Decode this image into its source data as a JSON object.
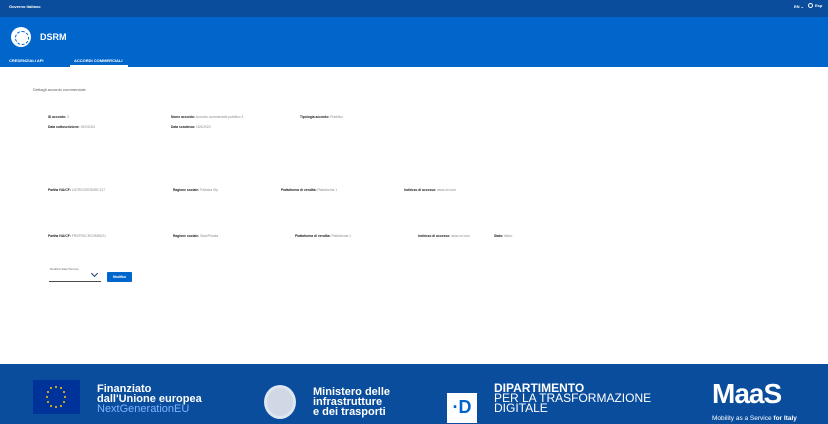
{
  "topbar": {
    "gov_label": "Governo Italiano",
    "lang": "EN ⌄",
    "user": "Esp"
  },
  "header": {
    "brand": "DSRM",
    "nav": [
      "CREDENZIALI API",
      "ACCORDI COMMERCIALI"
    ]
  },
  "main": {
    "section_title": "Dettagli accordo commerciale",
    "agreement": {
      "id_label": "ID accordo:",
      "id_value": "3",
      "name_label": "Nome accordo:",
      "name_value": "Accordo commerciale pubblico 3",
      "type_label": "Tipologia accordo:",
      "type_value": "Pubblico",
      "signed_label": "Data sottoscrizione:",
      "signed_value": "19/2/2024",
      "expiry_label": "Data scadenza:",
      "expiry_value": "15/4/2024"
    },
    "parties": [
      {
        "vat_label": "Partita IVA/CF:",
        "vat_value": "LNTRDCREDMRC217",
        "company_label": "Ragione sociale:",
        "company_value": "Palestra Sty",
        "platform_label": "Piattaforma di vendita:",
        "platform_value": "Piattaforma 1",
        "email_label": "Indirizzo di accesso:",
        "email_value": "www.url.com"
      },
      {
        "vat_label": "Partita IVA/CF:",
        "vat_value": "FRNTRDCRCHMBG21",
        "company_label": "Ragione sociale:",
        "company_value": "StarkPrivata",
        "platform_label": "Piattaforma di vendita:",
        "platform_value": "Piattaforma 1",
        "email_label": "Indirizzo di accesso:",
        "email_value": "www.url.com",
        "status_label": "Stato:",
        "status_value": "Attivo"
      }
    ],
    "select": {
      "label": "Modifica Stato/Termina"
    },
    "button": "Modifica"
  },
  "footer": {
    "eu": [
      "Finanziato",
      "dall'Unione europea",
      "NextGenerationEU"
    ],
    "ministry": [
      "Ministero delle",
      "infrastrutture",
      "e dei trasporti"
    ],
    "dip": [
      "DIPARTIMENTO",
      "PER LA TRASFORMAZIONE",
      "DIGITALE"
    ],
    "d_letter": "·D",
    "maas": "MaaS",
    "maas_sub_a": "Mobility as a Service ",
    "maas_sub_b": "for Italy"
  },
  "colors": {
    "topbar": "#0a4d9c",
    "header": "#0066cc",
    "footer": "#0a4d9c",
    "accent": "#0066cc"
  }
}
